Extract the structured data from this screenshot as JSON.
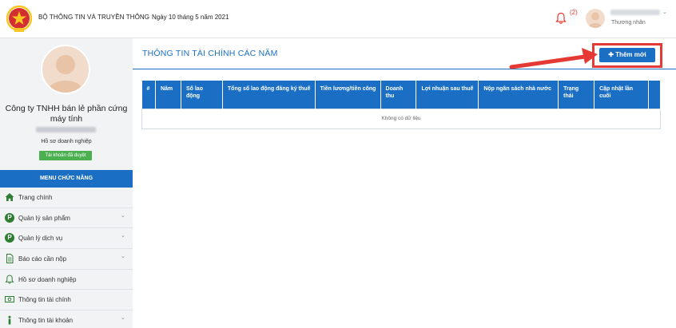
{
  "header": {
    "org_name": "BỘ THÔNG TIN VÀ TRUYỀN THÔNG",
    "date": "Ngày 10 tháng 5 năm 2021",
    "notification_count": "(2)",
    "user_role": "Thương nhân"
  },
  "sidebar": {
    "company_name": "Công ty TNHH bán lẻ phần cứng máy tính",
    "profile_label": "Hồ sơ doanh nghiệp",
    "approved_badge": "Tài khoản đã duyệt",
    "menu_header": "MENU CHỨC NĂNG",
    "items": [
      {
        "label": "Trang chính",
        "icon": "home-icon",
        "has_chevron": false
      },
      {
        "label": "Quản lý sản phẩm",
        "icon": "p-circle-icon",
        "has_chevron": true
      },
      {
        "label": "Quản lý dịch vụ",
        "icon": "p-circle-icon",
        "has_chevron": true
      },
      {
        "label": "Báo cáo cần nộp",
        "icon": "document-icon",
        "has_chevron": true
      },
      {
        "label": "Hồ sơ doanh nghiệp",
        "icon": "bell-icon",
        "has_chevron": false
      },
      {
        "label": "Thông tin tài chính",
        "icon": "money-icon",
        "has_chevron": false
      },
      {
        "label": "Thông tin tài khoản",
        "icon": "info-icon",
        "has_chevron": true
      }
    ]
  },
  "main": {
    "title": "THÔNG TIN TÀI CHÍNH CÁC NĂM",
    "add_button": "Thêm mới",
    "table": {
      "columns": [
        "#",
        "Năm",
        "Số lao động",
        "Tổng số lao động đăng ký thuế",
        "Tiền lương/tiền công",
        "Doanh thu",
        "Lợi nhuận sau thuế",
        "Nộp ngân sách nhà nước",
        "Trạng thái",
        "Cập nhật lần cuối",
        ""
      ],
      "empty_text": "Không có dữ liệu"
    }
  },
  "colors": {
    "primary": "#1a6fc4",
    "highlight": "#e53935",
    "approved": "#4caf50"
  }
}
